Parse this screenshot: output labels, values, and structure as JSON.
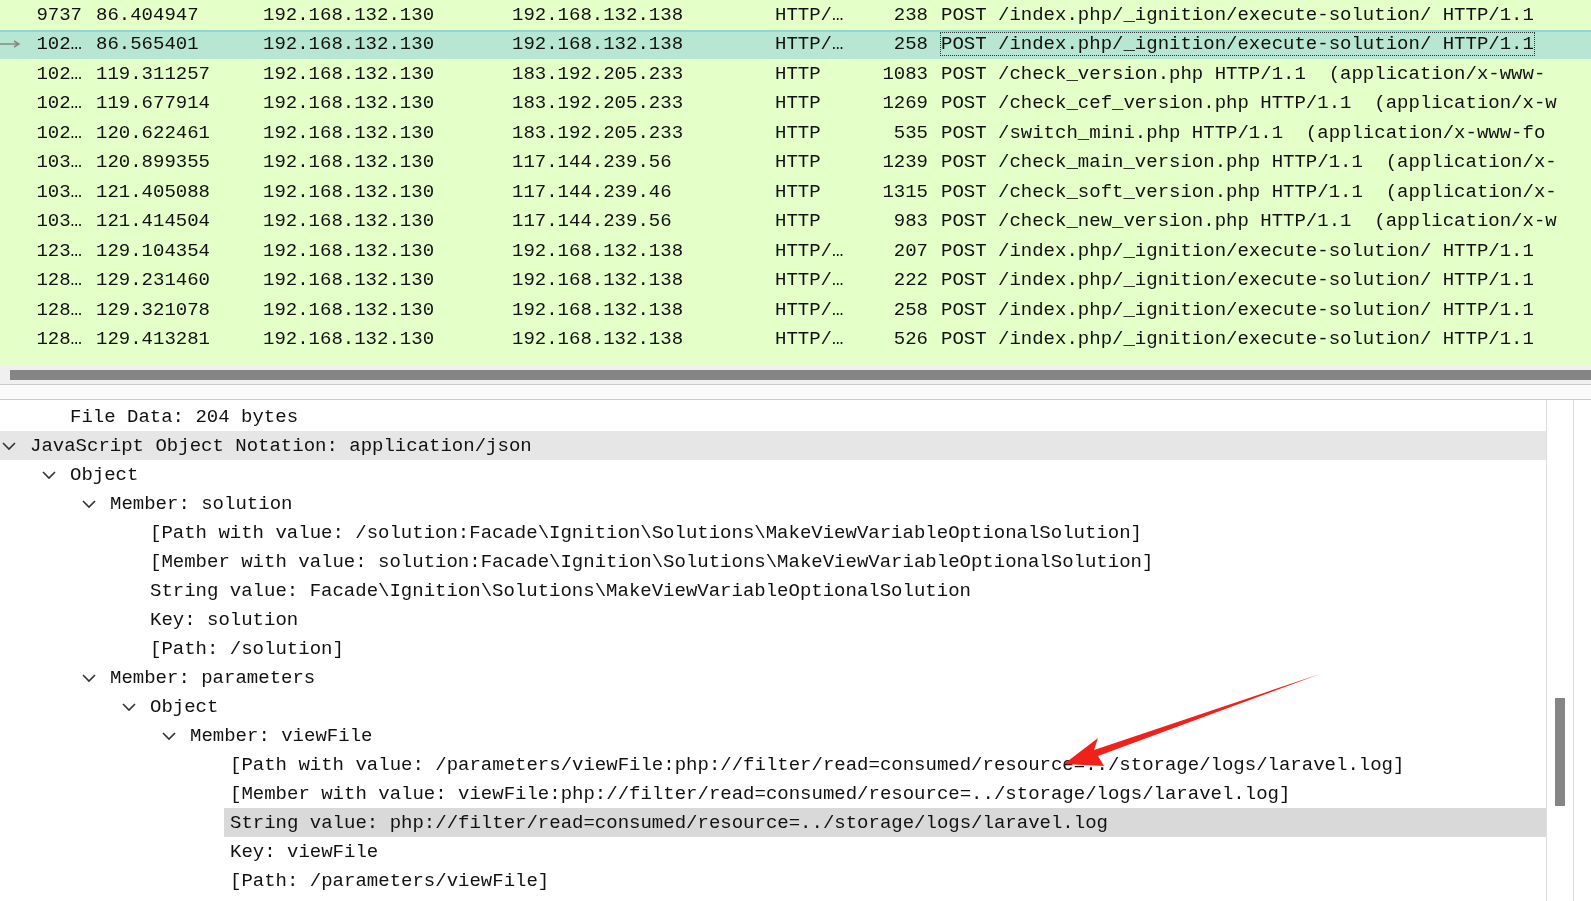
{
  "packet_list": {
    "rows": [
      {
        "no": "9737",
        "time": "86.404947",
        "source": "192.168.132.130",
        "destination": "192.168.132.138",
        "protocol": "HTTP/…",
        "length": "238",
        "info": "POST /index.php/_ignition/execute-solution/ HTTP/1.1",
        "selected": false
      },
      {
        "no": "102…",
        "time": "86.565401",
        "source": "192.168.132.130",
        "destination": "192.168.132.138",
        "protocol": "HTTP/…",
        "length": "258",
        "info": "POST /index.php/_ignition/execute-solution/ HTTP/1.1",
        "selected": true
      },
      {
        "no": "102…",
        "time": "119.311257",
        "source": "192.168.132.130",
        "destination": "183.192.205.233",
        "protocol": "HTTP",
        "length": "1083",
        "info": "POST /check_version.php HTTP/1.1  (application/x-www-",
        "selected": false
      },
      {
        "no": "102…",
        "time": "119.677914",
        "source": "192.168.132.130",
        "destination": "183.192.205.233",
        "protocol": "HTTP",
        "length": "1269",
        "info": "POST /check_cef_version.php HTTP/1.1  (application/x-w",
        "selected": false
      },
      {
        "no": "102…",
        "time": "120.622461",
        "source": "192.168.132.130",
        "destination": "183.192.205.233",
        "protocol": "HTTP",
        "length": "535",
        "info": "POST /switch_mini.php HTTP/1.1  (application/x-www-fo",
        "selected": false
      },
      {
        "no": "103…",
        "time": "120.899355",
        "source": "192.168.132.130",
        "destination": "117.144.239.56",
        "protocol": "HTTP",
        "length": "1239",
        "info": "POST /check_main_version.php HTTP/1.1  (application/x-",
        "selected": false
      },
      {
        "no": "103…",
        "time": "121.405088",
        "source": "192.168.132.130",
        "destination": "117.144.239.46",
        "protocol": "HTTP",
        "length": "1315",
        "info": "POST /check_soft_version.php HTTP/1.1  (application/x-",
        "selected": false
      },
      {
        "no": "103…",
        "time": "121.414504",
        "source": "192.168.132.130",
        "destination": "117.144.239.56",
        "protocol": "HTTP",
        "length": "983",
        "info": "POST /check_new_version.php HTTP/1.1  (application/x-w",
        "selected": false
      },
      {
        "no": "123…",
        "time": "129.104354",
        "source": "192.168.132.130",
        "destination": "192.168.132.138",
        "protocol": "HTTP/…",
        "length": "207",
        "info": "POST /index.php/_ignition/execute-solution/ HTTP/1.1",
        "selected": false
      },
      {
        "no": "128…",
        "time": "129.231460",
        "source": "192.168.132.130",
        "destination": "192.168.132.138",
        "protocol": "HTTP/…",
        "length": "222",
        "info": "POST /index.php/_ignition/execute-solution/ HTTP/1.1",
        "selected": false
      },
      {
        "no": "128…",
        "time": "129.321078",
        "source": "192.168.132.130",
        "destination": "192.168.132.138",
        "protocol": "HTTP/…",
        "length": "258",
        "info": "POST /index.php/_ignition/execute-solution/ HTTP/1.1",
        "selected": false
      },
      {
        "no": "128…",
        "time": "129.413281",
        "source": "192.168.132.130",
        "destination": "192.168.132.138",
        "protocol": "HTTP/…",
        "length": "526",
        "info": "POST /index.php/_ignition/execute-solution/ HTTP/1.1",
        "selected": false
      }
    ]
  },
  "details": {
    "top_leaf": {
      "text": "File Data: 204 bytes",
      "selected": false
    },
    "tree": [
      {
        "text": "JavaScript Object Notation: application/json",
        "kind": "protocol",
        "expanded": true,
        "selected": false,
        "children": [
          {
            "text": "Object",
            "expanded": true,
            "selected": false,
            "children": [
              {
                "text": "Member: solution",
                "expanded": true,
                "selected": false,
                "children": [
                  {
                    "text": "[Path with value: /solution:Facade\\Ignition\\Solutions\\MakeViewVariableOptionalSolution]",
                    "selected": false
                  },
                  {
                    "text": "[Member with value: solution:Facade\\Ignition\\Solutions\\MakeViewVariableOptionalSolution]",
                    "selected": false
                  },
                  {
                    "text": "String value: Facade\\Ignition\\Solutions\\MakeViewVariableOptionalSolution",
                    "selected": false
                  },
                  {
                    "text": "Key: solution",
                    "selected": false
                  },
                  {
                    "text": "[Path: /solution]",
                    "selected": false
                  }
                ]
              },
              {
                "text": "Member: parameters",
                "expanded": true,
                "selected": false,
                "children": [
                  {
                    "text": "Object",
                    "expanded": true,
                    "selected": false,
                    "children": [
                      {
                        "text": "Member: viewFile",
                        "expanded": true,
                        "selected": false,
                        "children": [
                          {
                            "text": "[Path with value: /parameters/viewFile:php://filter/read=consumed/resource=../storage/logs/laravel.log]",
                            "selected": false
                          },
                          {
                            "text": "[Member with value: viewFile:php://filter/read=consumed/resource=../storage/logs/laravel.log]",
                            "selected": false
                          },
                          {
                            "text": "String value: php://filter/read=consumed/resource=../storage/logs/laravel.log",
                            "selected": true
                          },
                          {
                            "text": "Key: viewFile",
                            "selected": false
                          },
                          {
                            "text": "[Path: /parameters/viewFile]",
                            "selected": false
                          }
                        ]
                      }
                    ]
                  }
                ]
              }
            ]
          }
        ]
      }
    ]
  }
}
